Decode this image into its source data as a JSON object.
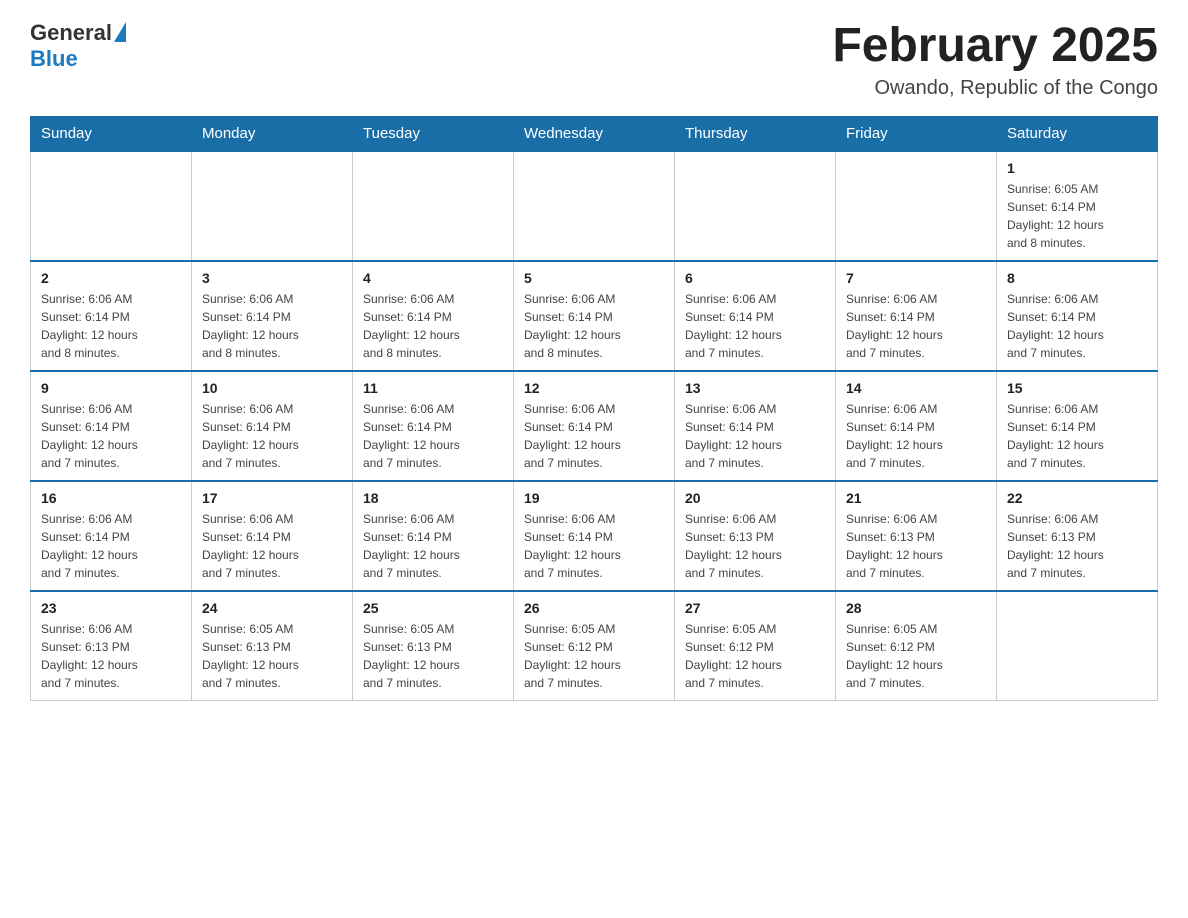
{
  "header": {
    "logo_general": "General",
    "logo_blue": "Blue",
    "month_title": "February 2025",
    "location": "Owando, Republic of the Congo"
  },
  "weekdays": [
    "Sunday",
    "Monday",
    "Tuesday",
    "Wednesday",
    "Thursday",
    "Friday",
    "Saturday"
  ],
  "weeks": [
    [
      {
        "day": "",
        "info": ""
      },
      {
        "day": "",
        "info": ""
      },
      {
        "day": "",
        "info": ""
      },
      {
        "day": "",
        "info": ""
      },
      {
        "day": "",
        "info": ""
      },
      {
        "day": "",
        "info": ""
      },
      {
        "day": "1",
        "info": "Sunrise: 6:05 AM\nSunset: 6:14 PM\nDaylight: 12 hours\nand 8 minutes."
      }
    ],
    [
      {
        "day": "2",
        "info": "Sunrise: 6:06 AM\nSunset: 6:14 PM\nDaylight: 12 hours\nand 8 minutes."
      },
      {
        "day": "3",
        "info": "Sunrise: 6:06 AM\nSunset: 6:14 PM\nDaylight: 12 hours\nand 8 minutes."
      },
      {
        "day": "4",
        "info": "Sunrise: 6:06 AM\nSunset: 6:14 PM\nDaylight: 12 hours\nand 8 minutes."
      },
      {
        "day": "5",
        "info": "Sunrise: 6:06 AM\nSunset: 6:14 PM\nDaylight: 12 hours\nand 8 minutes."
      },
      {
        "day": "6",
        "info": "Sunrise: 6:06 AM\nSunset: 6:14 PM\nDaylight: 12 hours\nand 7 minutes."
      },
      {
        "day": "7",
        "info": "Sunrise: 6:06 AM\nSunset: 6:14 PM\nDaylight: 12 hours\nand 7 minutes."
      },
      {
        "day": "8",
        "info": "Sunrise: 6:06 AM\nSunset: 6:14 PM\nDaylight: 12 hours\nand 7 minutes."
      }
    ],
    [
      {
        "day": "9",
        "info": "Sunrise: 6:06 AM\nSunset: 6:14 PM\nDaylight: 12 hours\nand 7 minutes."
      },
      {
        "day": "10",
        "info": "Sunrise: 6:06 AM\nSunset: 6:14 PM\nDaylight: 12 hours\nand 7 minutes."
      },
      {
        "day": "11",
        "info": "Sunrise: 6:06 AM\nSunset: 6:14 PM\nDaylight: 12 hours\nand 7 minutes."
      },
      {
        "day": "12",
        "info": "Sunrise: 6:06 AM\nSunset: 6:14 PM\nDaylight: 12 hours\nand 7 minutes."
      },
      {
        "day": "13",
        "info": "Sunrise: 6:06 AM\nSunset: 6:14 PM\nDaylight: 12 hours\nand 7 minutes."
      },
      {
        "day": "14",
        "info": "Sunrise: 6:06 AM\nSunset: 6:14 PM\nDaylight: 12 hours\nand 7 minutes."
      },
      {
        "day": "15",
        "info": "Sunrise: 6:06 AM\nSunset: 6:14 PM\nDaylight: 12 hours\nand 7 minutes."
      }
    ],
    [
      {
        "day": "16",
        "info": "Sunrise: 6:06 AM\nSunset: 6:14 PM\nDaylight: 12 hours\nand 7 minutes."
      },
      {
        "day": "17",
        "info": "Sunrise: 6:06 AM\nSunset: 6:14 PM\nDaylight: 12 hours\nand 7 minutes."
      },
      {
        "day": "18",
        "info": "Sunrise: 6:06 AM\nSunset: 6:14 PM\nDaylight: 12 hours\nand 7 minutes."
      },
      {
        "day": "19",
        "info": "Sunrise: 6:06 AM\nSunset: 6:14 PM\nDaylight: 12 hours\nand 7 minutes."
      },
      {
        "day": "20",
        "info": "Sunrise: 6:06 AM\nSunset: 6:13 PM\nDaylight: 12 hours\nand 7 minutes."
      },
      {
        "day": "21",
        "info": "Sunrise: 6:06 AM\nSunset: 6:13 PM\nDaylight: 12 hours\nand 7 minutes."
      },
      {
        "day": "22",
        "info": "Sunrise: 6:06 AM\nSunset: 6:13 PM\nDaylight: 12 hours\nand 7 minutes."
      }
    ],
    [
      {
        "day": "23",
        "info": "Sunrise: 6:06 AM\nSunset: 6:13 PM\nDaylight: 12 hours\nand 7 minutes."
      },
      {
        "day": "24",
        "info": "Sunrise: 6:05 AM\nSunset: 6:13 PM\nDaylight: 12 hours\nand 7 minutes."
      },
      {
        "day": "25",
        "info": "Sunrise: 6:05 AM\nSunset: 6:13 PM\nDaylight: 12 hours\nand 7 minutes."
      },
      {
        "day": "26",
        "info": "Sunrise: 6:05 AM\nSunset: 6:12 PM\nDaylight: 12 hours\nand 7 minutes."
      },
      {
        "day": "27",
        "info": "Sunrise: 6:05 AM\nSunset: 6:12 PM\nDaylight: 12 hours\nand 7 minutes."
      },
      {
        "day": "28",
        "info": "Sunrise: 6:05 AM\nSunset: 6:12 PM\nDaylight: 12 hours\nand 7 minutes."
      },
      {
        "day": "",
        "info": ""
      }
    ]
  ]
}
